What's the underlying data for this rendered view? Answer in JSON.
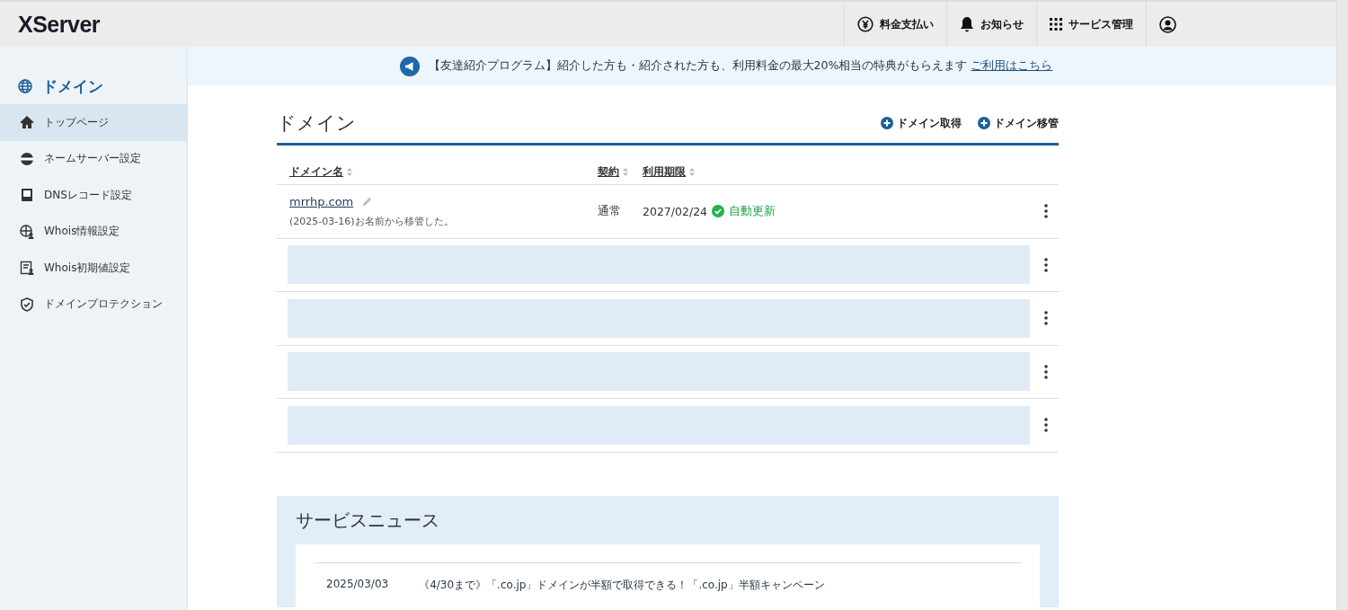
{
  "header": {
    "logo": "XServer",
    "nav": [
      "料金支払い",
      "お知らせ",
      "サービス管理"
    ]
  },
  "sidebar": {
    "title": "ドメイン",
    "items": [
      {
        "label": "トップページ",
        "selected": true
      },
      {
        "label": "ネームサーバー設定",
        "selected": false
      },
      {
        "label": "DNSレコード設定",
        "selected": false
      },
      {
        "label": "Whois情報設定",
        "selected": false
      },
      {
        "label": "Whois初期値設定",
        "selected": false
      },
      {
        "label": "ドメインプロテクション",
        "selected": false
      }
    ]
  },
  "banner": {
    "text": "【友達紹介プログラム】紹介した方も・紹介された方も、利用料金の最大20%相当の特典がもらえます",
    "link": "ご利用はこちら"
  },
  "domains": {
    "title": "ドメイン",
    "actions": [
      "ドメイン取得",
      "ドメイン移管"
    ],
    "columns": [
      "ドメイン名",
      "契約",
      "利用期限"
    ],
    "rows": [
      {
        "kind": "domain",
        "name": "mrrhp.com",
        "note": "(2025-03-16)お名前から移管した。",
        "contract": "通常",
        "expiry": "2027/02/24",
        "auto_renew": true,
        "auto_renew_label": "自動更新"
      },
      {
        "kind": "placeholder"
      },
      {
        "kind": "placeholder"
      },
      {
        "kind": "placeholder"
      },
      {
        "kind": "placeholder"
      }
    ]
  },
  "news": {
    "title": "サービスニュース",
    "items": [
      {
        "date": "2025/03/03",
        "text": "《4/30まで》「.co.jp」ドメインが半額で取得できる！「.co.jp」半額キャンペーン"
      }
    ]
  }
}
